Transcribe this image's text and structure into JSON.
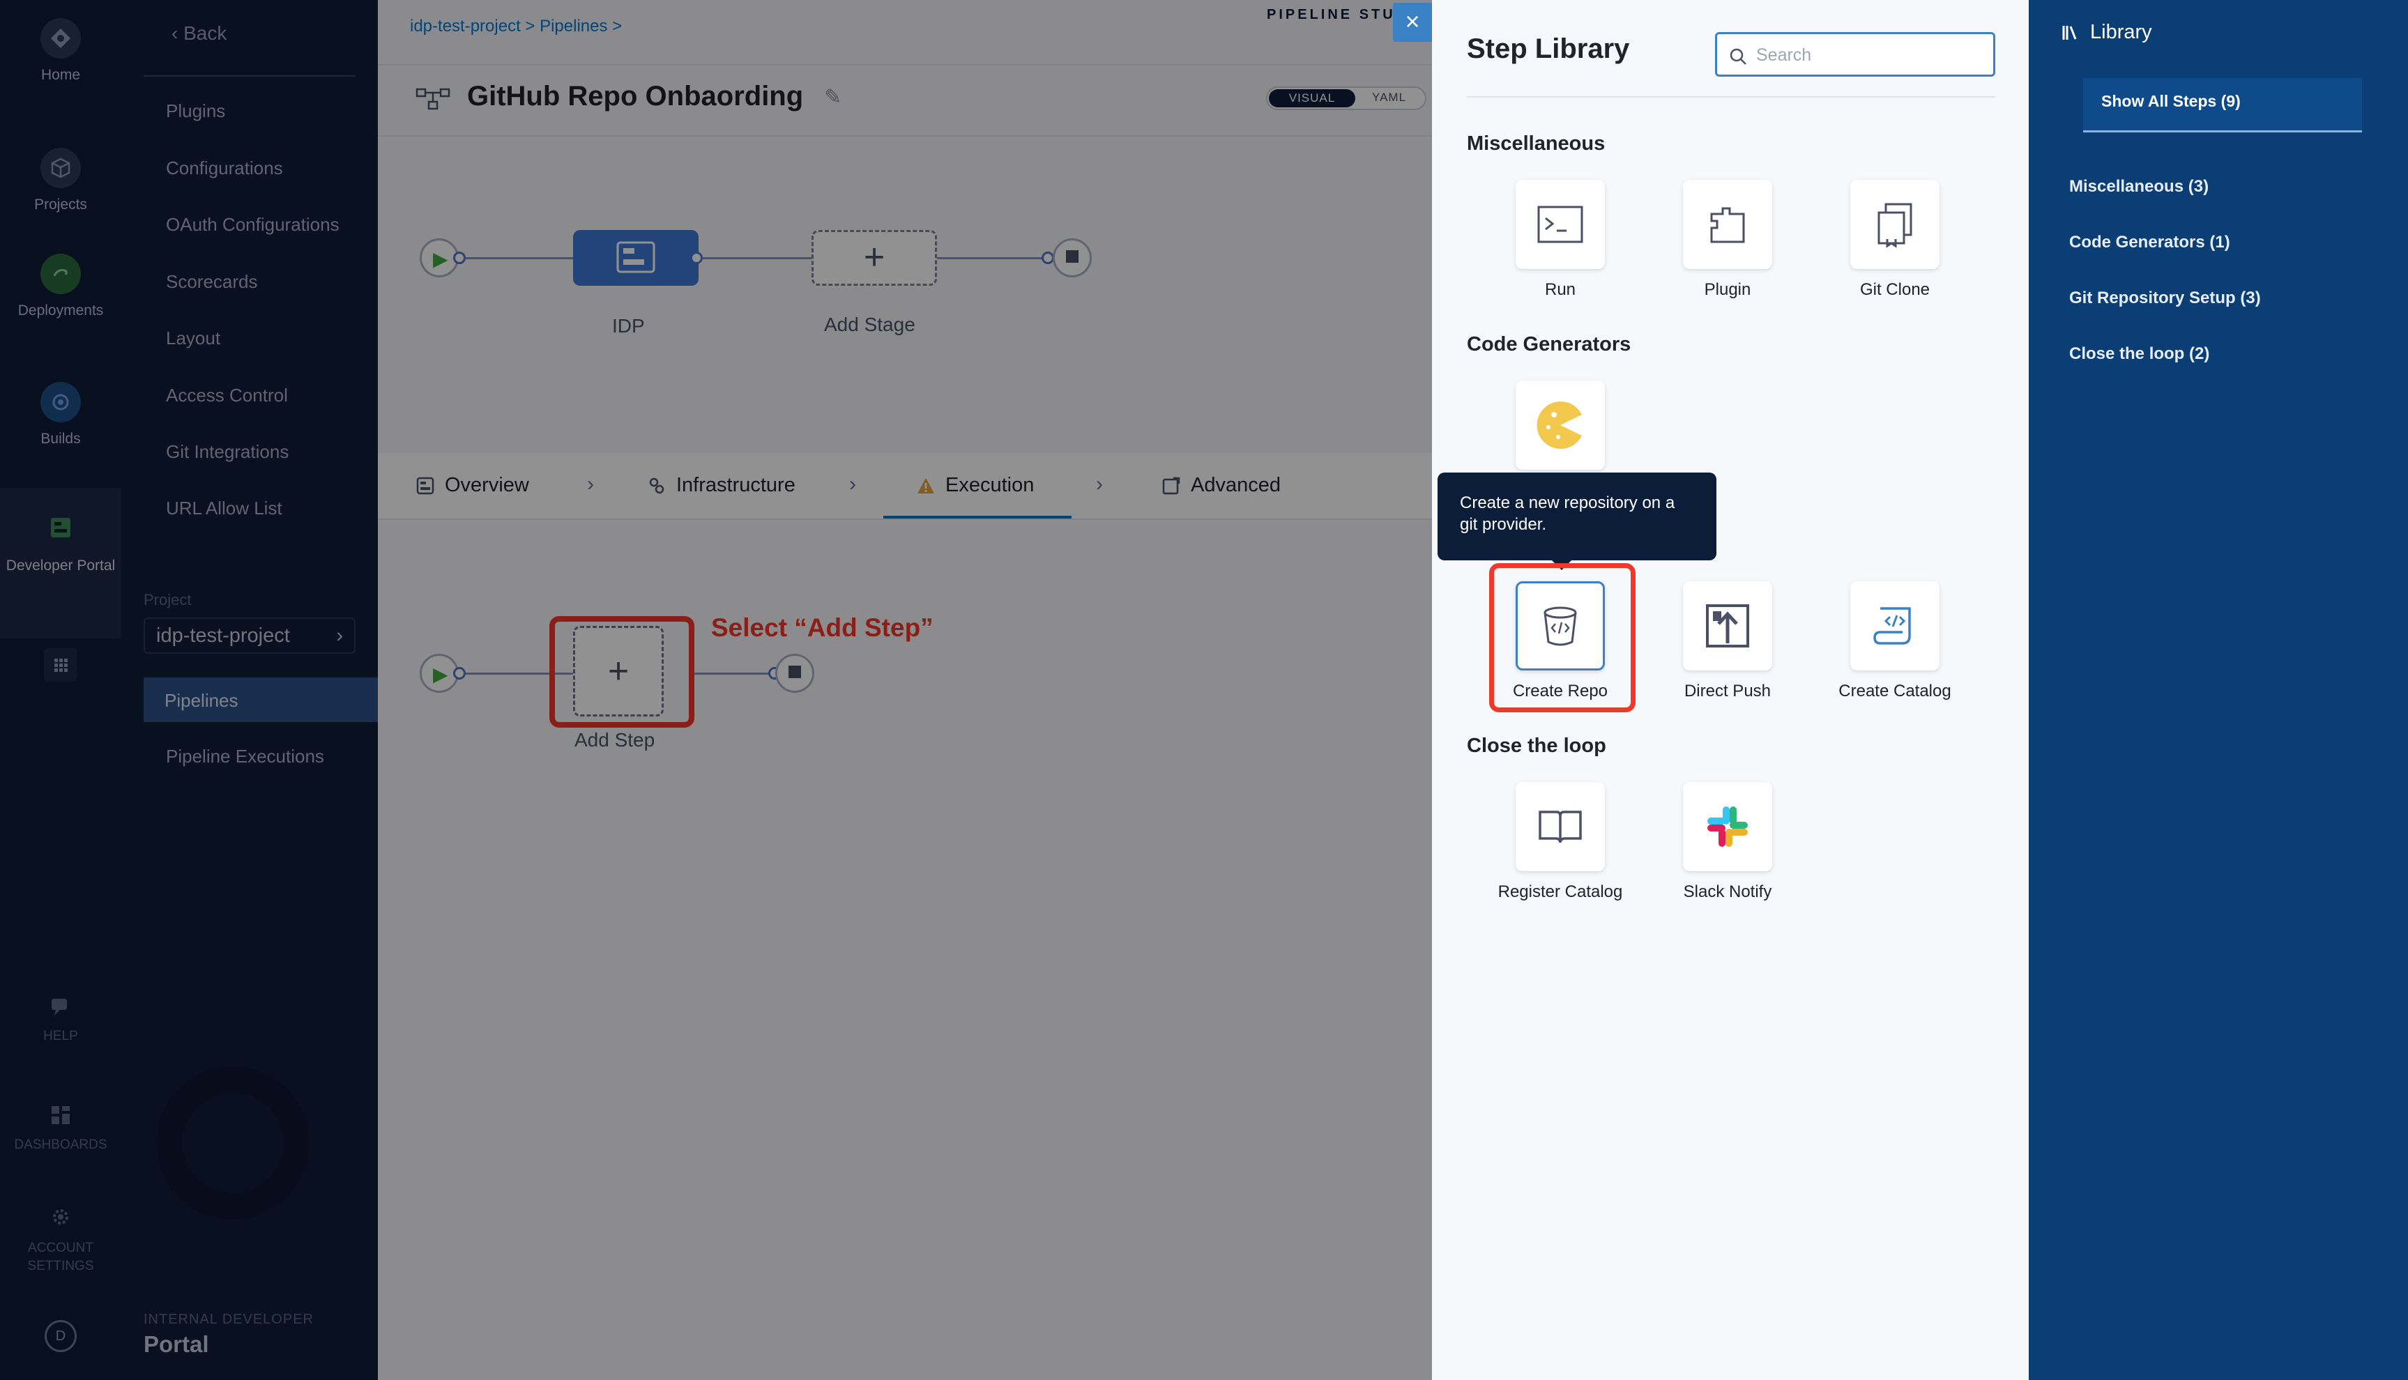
{
  "nav": {
    "items": [
      {
        "label": "Home",
        "icon": "home-icon"
      },
      {
        "label": "Projects",
        "icon": "cube-icon"
      },
      {
        "label": "Deployments",
        "icon": "deploy-icon"
      },
      {
        "label": "Builds",
        "icon": "builds-icon"
      },
      {
        "label": "Developer Portal",
        "icon": "portal-icon"
      }
    ],
    "bottom": [
      {
        "label": "HELP",
        "icon": "help-icon"
      },
      {
        "label": "DASHBOARDS",
        "icon": "dashboards-icon"
      },
      {
        "label": "ACCOUNT SETTINGS",
        "icon": "settings-icon"
      }
    ],
    "avatar": "D"
  },
  "side_menu": {
    "back": "Back",
    "links": [
      "Plugins",
      "Configurations",
      "OAuth Configurations",
      "Scorecards",
      "Layout",
      "Access Control",
      "Git Integrations",
      "URL Allow List"
    ],
    "project_label": "Project",
    "project_value": "idp-test-project",
    "pipelines": "Pipelines",
    "pipeline_executions": "Pipeline Executions",
    "footer_small": "INTERNAL DEVELOPER",
    "footer_big": "Portal"
  },
  "header": {
    "breadcrumb": "idp-test-project  >  Pipelines  >",
    "studio": "PIPELINE STUDIO",
    "title": "GitHub Repo Onbaording",
    "view_visual": "VISUAL",
    "view_yaml": "YAML"
  },
  "stages": {
    "stage_name": "IDP",
    "add_stage": "Add Stage",
    "plus": "+"
  },
  "tabs": [
    {
      "label": "Overview",
      "icon": "overview-icon"
    },
    {
      "label": "Infrastructure",
      "icon": "infrastructure-icon"
    },
    {
      "label": "Execution",
      "icon": "warning-icon",
      "active": true
    },
    {
      "label": "Advanced",
      "icon": "advanced-icon"
    }
  ],
  "execution": {
    "add_step": "Add Step",
    "plus": "+",
    "annotation": "Select “Add Step”"
  },
  "step_library": {
    "title": "Step Library",
    "search_placeholder": "Search",
    "categories": [
      {
        "name": "Miscellaneous",
        "steps": [
          {
            "label": "Run",
            "icon": "terminal-icon"
          },
          {
            "label": "Plugin",
            "icon": "plugin-icon"
          },
          {
            "label": "Git Clone",
            "icon": "git-clone-icon"
          }
        ]
      },
      {
        "name": "Code Generators",
        "steps": [
          {
            "label": "",
            "icon": "cookiecutter-icon"
          }
        ]
      },
      {
        "name": "Git Repository Setup",
        "steps": [
          {
            "label": "Create Repo",
            "icon": "create-repo-icon"
          },
          {
            "label": "Direct Push",
            "icon": "direct-push-icon"
          },
          {
            "label": "Create Catalog",
            "icon": "create-catalog-icon"
          }
        ]
      },
      {
        "name": "Close the loop",
        "steps": [
          {
            "label": "Register Catalog",
            "icon": "register-catalog-icon"
          },
          {
            "label": "Slack Notify",
            "icon": "slack-icon"
          }
        ]
      }
    ],
    "tooltip": "Create a new repository on a git provider."
  },
  "library": {
    "title": "Library",
    "show_all": "Show All Steps (9)",
    "items": [
      "Miscellaneous (3)",
      "Code Generators (1)",
      "Git Repository Setup (3)",
      "Close the loop (2)"
    ]
  },
  "colors": {
    "accent": "#0278d5",
    "highlight": "#f2382b",
    "library_bg": "#0b3e75",
    "nav_bg": "#0f1c36"
  }
}
